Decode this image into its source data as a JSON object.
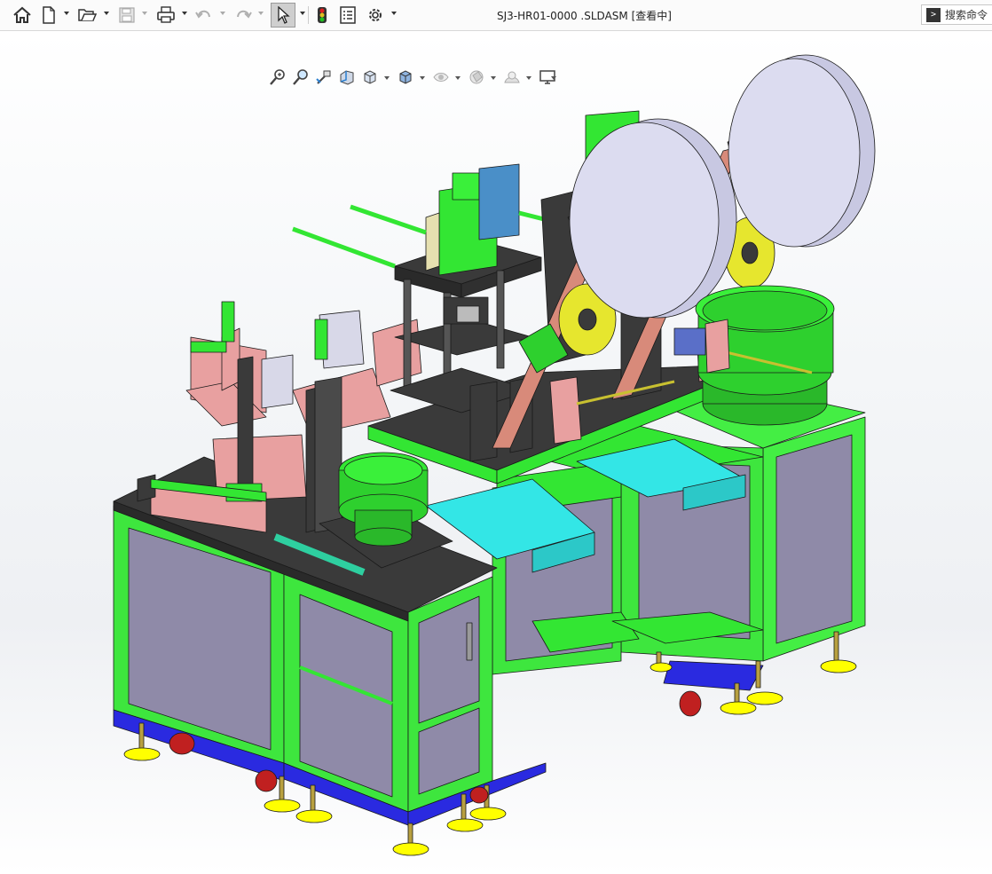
{
  "window": {
    "title": "SJ3-HR01-0000 .SLDASM [查看中]"
  },
  "toolbar": {
    "items": [
      {
        "name": "home-button",
        "icon": "home-icon"
      },
      {
        "name": "new-document-button",
        "icon": "new-document-icon"
      },
      {
        "name": "open-button",
        "icon": "open-folder-icon"
      },
      {
        "name": "save-button",
        "icon": "save-icon"
      },
      {
        "name": "print-button",
        "icon": "printer-icon"
      },
      {
        "name": "undo-button",
        "icon": "undo-icon"
      },
      {
        "name": "redo-button",
        "icon": "redo-icon"
      },
      {
        "name": "select-button",
        "icon": "cursor-arrow-icon"
      },
      {
        "name": "rebuild-button",
        "icon": "traffic-light-icon"
      },
      {
        "name": "file-properties-button",
        "icon": "file-properties-icon"
      },
      {
        "name": "options-button",
        "icon": "gear-icon"
      }
    ]
  },
  "search": {
    "placeholder": "搜索命令",
    "icon": "command-prompt-icon"
  },
  "heads_up_toolbar": {
    "items": [
      {
        "name": "zoom-to-fit-button",
        "icon": "zoom-to-fit-icon"
      },
      {
        "name": "zoom-to-area-button",
        "icon": "zoom-to-area-icon"
      },
      {
        "name": "previous-view-button",
        "icon": "previous-view-icon"
      },
      {
        "name": "section-view-button",
        "icon": "section-view-icon"
      },
      {
        "name": "view-orientation-button",
        "icon": "view-orientation-icon"
      },
      {
        "name": "display-style-button",
        "icon": "display-style-icon"
      },
      {
        "name": "hide-show-items-button",
        "icon": "eye-icon"
      },
      {
        "name": "edit-appearance-button",
        "icon": "appearance-icon"
      },
      {
        "name": "apply-scene-button",
        "icon": "scene-icon"
      },
      {
        "name": "view-settings-button",
        "icon": "monitor-icon"
      }
    ]
  },
  "colors": {
    "frame_green": "#33e633",
    "panel_gray": "#8f8aa8",
    "cyan_tray": "#33e6e6",
    "pink_part": "#e8a0a0",
    "dark_plate": "#3a3a3a",
    "yellow_reel": "#e6e62e",
    "disc_lavender": "#dcdcf0",
    "foot_yellow": "#ffff00",
    "caster_red": "#c02020",
    "base_blue": "#2a2ae0"
  }
}
